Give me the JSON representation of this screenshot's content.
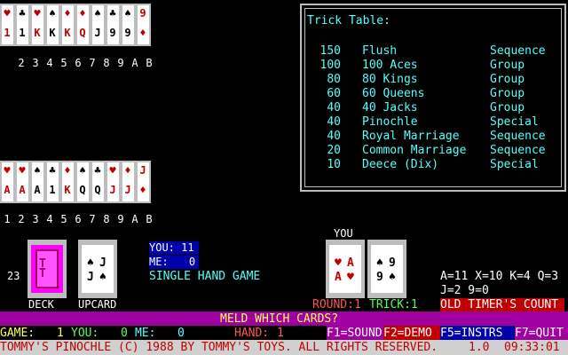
{
  "opponent_hand": {
    "cards": [
      {
        "r1": "♥",
        "r2": "1",
        "color": "red"
      },
      {
        "r1": "♣",
        "r2": "1",
        "color": "blk"
      },
      {
        "r1": "♥",
        "r2": "K",
        "color": "red"
      },
      {
        "r1": "♠",
        "r2": "K",
        "color": "blk"
      },
      {
        "r1": "♦",
        "r2": "K",
        "color": "red"
      },
      {
        "r1": "♦",
        "r2": "Q",
        "color": "red"
      },
      {
        "r1": "♠",
        "r2": "J",
        "color": "blk"
      },
      {
        "r1": "♣",
        "r2": "9",
        "color": "blk"
      },
      {
        "r1": "♠",
        "r2": "9",
        "color": "blk"
      },
      {
        "r1": "9",
        "r2": "♦",
        "color": "red"
      }
    ],
    "indices": [
      "2",
      "3",
      "4",
      "5",
      "6",
      "7",
      "8",
      "9",
      "A",
      "B"
    ]
  },
  "player_hand": {
    "cards": [
      {
        "r1": "♥",
        "r2": "A",
        "color": "red"
      },
      {
        "r1": "♥",
        "r2": "A",
        "color": "red"
      },
      {
        "r1": "♠",
        "r2": "A",
        "color": "blk"
      },
      {
        "r1": "♣",
        "r2": "1",
        "color": "blk"
      },
      {
        "r1": "♦",
        "r2": "K",
        "color": "red"
      },
      {
        "r1": "♠",
        "r2": "Q",
        "color": "blk"
      },
      {
        "r1": "♣",
        "r2": "Q",
        "color": "blk"
      },
      {
        "r1": "♥",
        "r2": "J",
        "color": "red"
      },
      {
        "r1": "♦",
        "r2": "J",
        "color": "red"
      },
      {
        "r1": "J",
        "r2": "♦",
        "color": "red"
      }
    ],
    "indices": [
      "1",
      "2",
      "3",
      "4",
      "5",
      "6",
      "7",
      "8",
      "9",
      "A",
      "B"
    ]
  },
  "trick_table": {
    "title": "Trick Table:",
    "rows": [
      {
        "pts": "150",
        "name": "Flush",
        "type": "Sequence"
      },
      {
        "pts": "100",
        "name": "100 Aces",
        "type": "Group"
      },
      {
        "pts": "80",
        "name": "80 Kings",
        "type": "Group"
      },
      {
        "pts": "60",
        "name": "60 Queens",
        "type": "Group"
      },
      {
        "pts": "40",
        "name": "40 Jacks",
        "type": "Group"
      },
      {
        "pts": "40",
        "name": "Pinochle",
        "type": "Special"
      },
      {
        "pts": "40",
        "name": "Royal Marriage",
        "type": "Sequence"
      },
      {
        "pts": "20",
        "name": "Common Marriage",
        "type": "Sequence"
      },
      {
        "pts": "10",
        "name": "Deece (Dix)",
        "type": "Special"
      }
    ]
  },
  "deck": {
    "count": "23",
    "label": "DECK",
    "back_text": "TT"
  },
  "upcard": {
    "label": "UPCARD",
    "rank": "J",
    "suit": "♠"
  },
  "score": {
    "you_label": "YOU:",
    "you_value": "11",
    "me_label": "ME:",
    "me_value": "0",
    "mode": "SINGLE HAND GAME"
  },
  "trick_area": {
    "you_label": "YOU",
    "card1": {
      "rank": "A",
      "suit": "♥"
    },
    "card2": {
      "rank": "9",
      "suit": "♠"
    },
    "round": "ROUND:1",
    "trick": "TRICK:1"
  },
  "values_legend": {
    "line1": "A=11 X=10 K=4 Q=3",
    "line2": "J=2 9=0"
  },
  "count_mode": "OLD TIMER'S COUNT",
  "prompt": "MELD WHICH CARDS?",
  "status": {
    "game_label": "GAME:",
    "game_value": "1",
    "you_label": "YOU:",
    "you_value": "0",
    "me_label": "ME:",
    "me_value": "0",
    "hand_label": "HAND:",
    "hand_value": "1",
    "f1": "F1=SOUND",
    "f2": "F2=DEMO",
    "f5": "F5=INSTRS",
    "f7": "F7=QUIT"
  },
  "footer": {
    "copyright": "TOMMY'S PINOCHLE (C) 1988 BY TOMMY'S TOYS. ALL RIGHTS RESERVED.",
    "version": "1.0",
    "clock": "09:33:01"
  }
}
